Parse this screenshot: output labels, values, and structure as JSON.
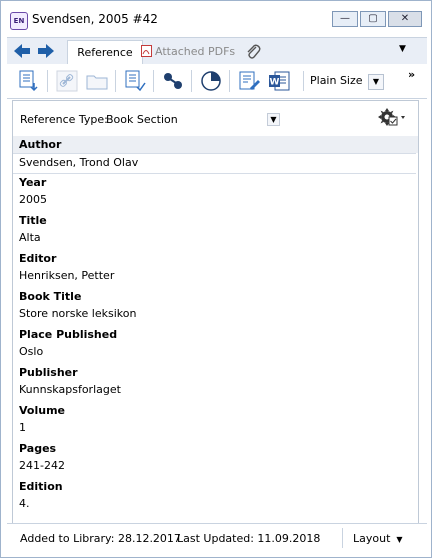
{
  "window": {
    "icon_text": "EN",
    "title": "Svendsen, 2005 #42",
    "minimize_glyph": "—",
    "maximize_glyph": "▢",
    "close_glyph": "✕"
  },
  "tabs": {
    "reference": "Reference",
    "attached_pdfs": "Attached PDFs",
    "menu_glyph": "▼"
  },
  "toolbar": {
    "plain_size": "Plain Size",
    "dropdown_glyph": "▼",
    "more_glyph": "»"
  },
  "reference_type": {
    "label": "Reference Type:",
    "value": "Book Section",
    "dropdown_glyph": "▼"
  },
  "fields": [
    {
      "label": "Author",
      "value": "Svendsen, Trond Olav"
    },
    {
      "label": "Year",
      "value": "2005"
    },
    {
      "label": "Title",
      "value": "Alta"
    },
    {
      "label": "Editor",
      "value": "Henriksen, Petter"
    },
    {
      "label": "Book Title",
      "value": "Store norske leksikon"
    },
    {
      "label": "Place Published",
      "value": "Oslo"
    },
    {
      "label": "Publisher",
      "value": "Kunnskapsforlaget"
    },
    {
      "label": "Volume",
      "value": "1"
    },
    {
      "label": "Pages",
      "value": "241-242"
    },
    {
      "label": "Edition",
      "value": "4."
    }
  ],
  "status": {
    "added": "Added to Library: 28.12.2017",
    "updated": "Last Updated: 11.09.2018",
    "layout": "Layout",
    "layout_glyph": "▼"
  },
  "colors": {
    "nav_arrow": "#1f5fa8",
    "accent": "#2f6fbf",
    "selected_label_bg": "#eceff4"
  }
}
